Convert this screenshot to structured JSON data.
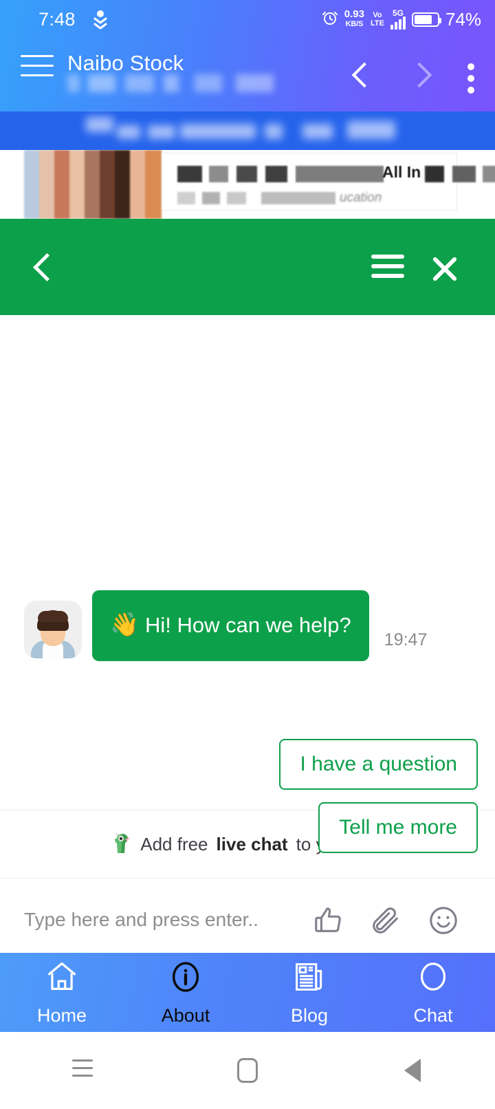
{
  "colors": {
    "brand_green": "#0da04a",
    "chrome_blue_start": "#35a1fb",
    "chrome_blue_end": "#7a54fd",
    "nav_blue": "#4f83fa"
  },
  "status_bar": {
    "time": "7:48",
    "download_icon": "download-arrow-icon",
    "alarm_icon": "alarm-clock-icon",
    "net_speed_value": "0.93",
    "net_speed_unit": "KB/S",
    "volte_line1": "Vo",
    "volte_line2": "LTE",
    "network_type": "5G",
    "signal_icon": "signal-bars-icon",
    "battery_icon": "battery-icon",
    "battery_percent": "74%"
  },
  "browser": {
    "menu_icon": "hamburger-menu-icon",
    "title": "Naibo Stock",
    "url_placeholder": "",
    "back_icon": "chevron-left-icon",
    "forward_icon": "chevron-right-icon",
    "overflow_icon": "kebab-menu-icon"
  },
  "page_card": {
    "headline_visible_fragment": "All In",
    "subline_visible_fragment": "ucation"
  },
  "chat_widget": {
    "header": {
      "back_icon": "chevron-left-icon",
      "menu_icon": "hamburger-menu-icon",
      "close_icon": "close-x-icon"
    },
    "messages": [
      {
        "avatar_icon": "agent-avatar",
        "emoji": "👋",
        "text": "Hi! How can we help?",
        "time": "19:47"
      }
    ],
    "quick_replies": [
      {
        "label": "I have a question"
      },
      {
        "label": "Tell me more"
      }
    ],
    "branding": {
      "icon": "tawk-bird-icon",
      "prefix": "Add free",
      "emphasis": "live chat",
      "suffix": "to your site"
    },
    "composer": {
      "placeholder": "Type here and press enter..",
      "value": "",
      "like_icon": "thumbs-up-icon",
      "attach_icon": "paperclip-icon",
      "emoji_icon": "smiley-face-icon"
    }
  },
  "app_nav": {
    "items": [
      {
        "label": "Home",
        "icon": "home-icon",
        "active": false
      },
      {
        "label": "About",
        "icon": "info-circle-icon",
        "active": true
      },
      {
        "label": "Blog",
        "icon": "newspaper-icon",
        "active": false
      },
      {
        "label": "Chat",
        "icon": "chat-circle-icon",
        "active": false
      }
    ]
  },
  "system_nav": {
    "recent_icon": "recents-icon",
    "home_icon": "home-square-icon",
    "back_icon": "back-triangle-icon"
  }
}
